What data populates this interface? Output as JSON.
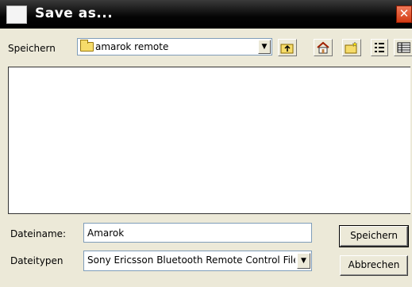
{
  "window": {
    "title": "Save as...",
    "close_glyph": "✕"
  },
  "location": {
    "label": "Speichern",
    "current_folder": "amarok remote",
    "folder_icon": "folder-icon"
  },
  "toolbar": {
    "buttons": [
      "up-folder-icon",
      "home-icon",
      "new-folder-icon",
      "list-view-icon",
      "detail-view-icon"
    ]
  },
  "file_list": {
    "items": []
  },
  "file_name": {
    "label": "Dateiname:",
    "value": "Amarok"
  },
  "file_type": {
    "label": "Dateitypen",
    "selected": "Sony Ericsson Bluetooth Remote Control File"
  },
  "actions": {
    "save_label": "Speichern",
    "cancel_label": "Abbrechen"
  }
}
